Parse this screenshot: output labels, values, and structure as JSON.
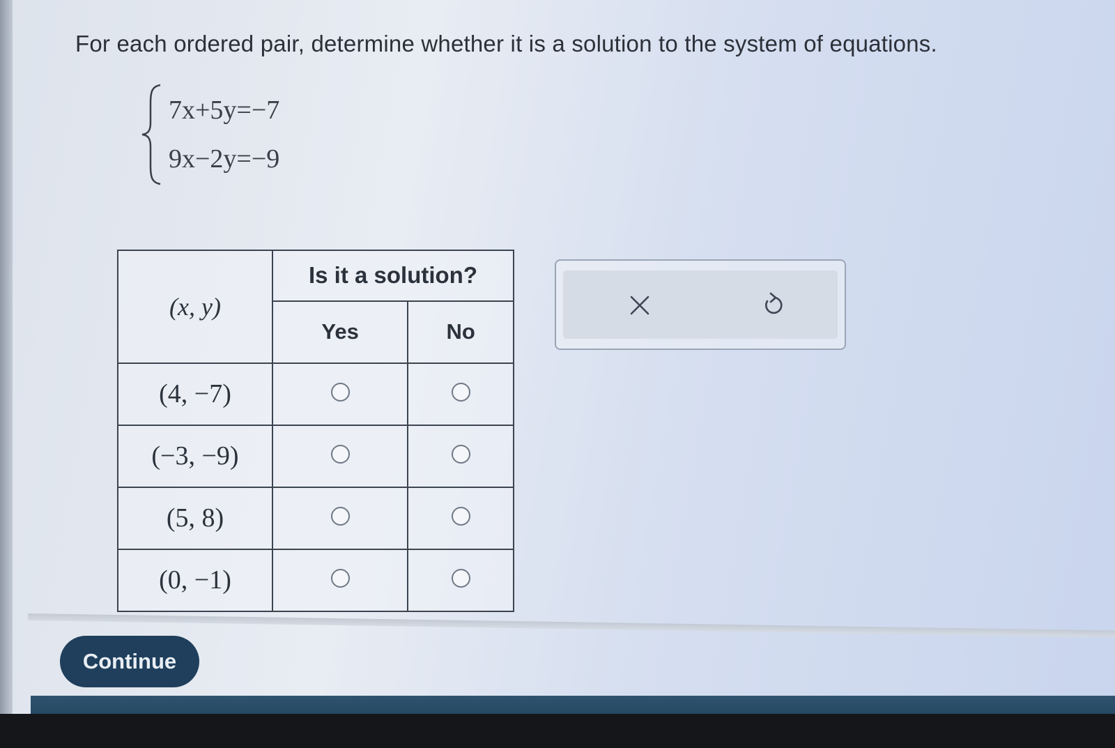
{
  "prompt": "For each ordered pair, determine whether it is a solution to the system of equations.",
  "system": {
    "equations": [
      "7x+5y=−7",
      "9x−2y=−9"
    ]
  },
  "table": {
    "pair_header": "(x, y)",
    "solution_header": "Is it a solution?",
    "yes_label": "Yes",
    "no_label": "No",
    "rows": [
      {
        "pair": "(4, −7)",
        "yes_selected": false,
        "no_selected": false
      },
      {
        "pair": "(−3, −9)",
        "yes_selected": false,
        "no_selected": false
      },
      {
        "pair": "(5, 8)",
        "yes_selected": false,
        "no_selected": false
      },
      {
        "pair": "(0, −1)",
        "yes_selected": false,
        "no_selected": false
      }
    ]
  },
  "tools": {
    "clear_icon": "close-icon",
    "undo_icon": "undo-icon"
  },
  "continue_label": "Continue",
  "colors": {
    "continue_bg": "#1f3f5c",
    "footer_bar": "#2f5470"
  }
}
